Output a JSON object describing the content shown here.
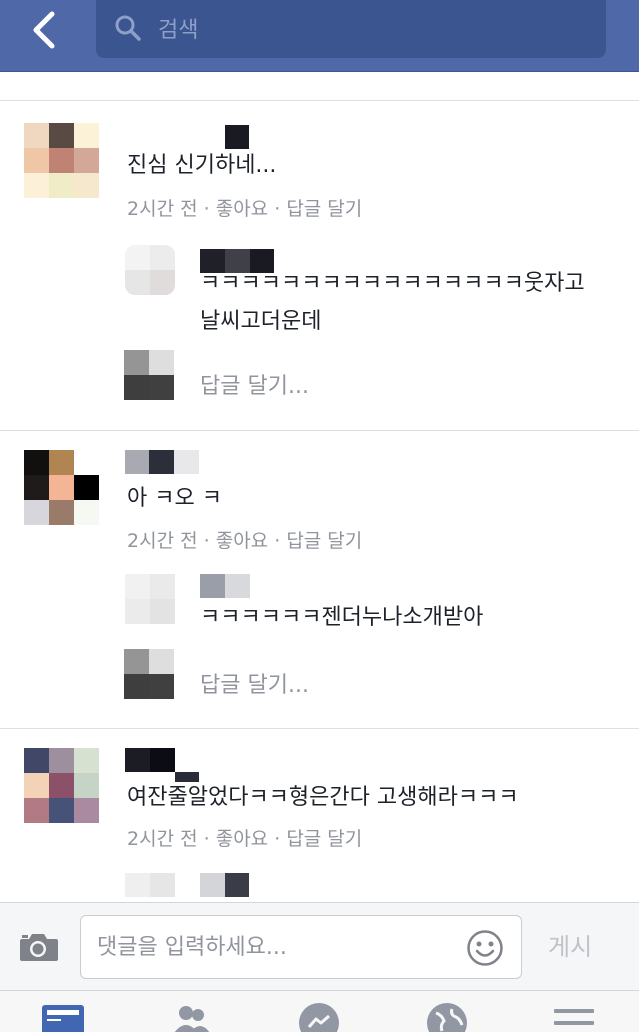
{
  "header": {
    "back_icon": "chevron-left-icon",
    "search_placeholder": "검색"
  },
  "comments": [
    {
      "text": "진심 신기하네...",
      "time": "2시간 전",
      "like": "좋아요",
      "reply": "답글 달기",
      "reply_item": {
        "text_line1": "ㅋㅋㅋㅋㅋㅋㅋㅋㅋㅋㅋㅋㅋㅋㅋㅋ웃자고",
        "text_line2": "날씨고더운데"
      },
      "reply_placeholder": "답글 달기..."
    },
    {
      "text": "아 ㅋ오 ㅋ",
      "time": "2시간 전",
      "like": "좋아요",
      "reply": "답글 달기",
      "reply_item": {
        "text_line1": "ㅋㅋㅋㅋㅋㅋ젠더누나소개받아"
      },
      "reply_placeholder": "답글 달기..."
    },
    {
      "text": "여잔줄알었다ㅋㅋ형은간다 고생해라ㅋㅋㅋ",
      "time": "2시간 전",
      "like": "좋아요",
      "reply": "답글 달기"
    }
  ],
  "meta_separator": "·",
  "composer": {
    "placeholder": "댓글을 입력하세요...",
    "post_label": "게시",
    "camera_icon": "camera-icon",
    "emoji_icon": "smiley-icon"
  },
  "tabbar": {
    "tabs": [
      "news-feed-icon",
      "friends-icon",
      "messenger-icon",
      "globe-icon",
      "menu-icon"
    ],
    "active_color": "#4267b2",
    "inactive_color": "#9197a3"
  },
  "colors": {
    "header_bg": "#4f69a8",
    "search_bg": "#3b5591",
    "meta_text": "#90949c"
  }
}
